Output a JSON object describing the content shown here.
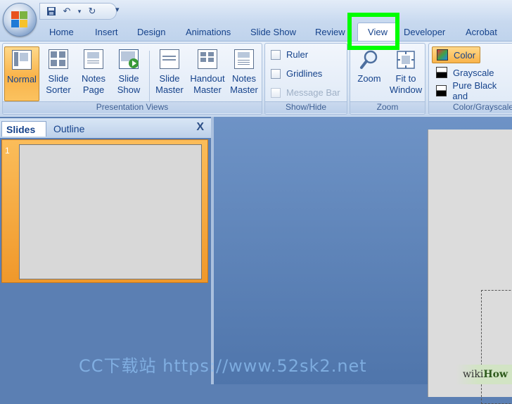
{
  "quick_access": {
    "icons": [
      "save-icon",
      "undo-icon",
      "redo-icon",
      "customize-icon"
    ],
    "undo_glyph": "↶",
    "redo_glyph": "↻",
    "more_glyph": "▾",
    "menu_glyph": "▾"
  },
  "tabs": [
    "Home",
    "Insert",
    "Design",
    "Animations",
    "Slide Show",
    "Review",
    "View",
    "Developer",
    "Acrobat"
  ],
  "active_tab": "View",
  "ribbon": {
    "presentation_views": {
      "label": "Presentation Views",
      "buttons": [
        {
          "line1": "Normal",
          "line2": "",
          "active": true
        },
        {
          "line1": "Slide",
          "line2": "Sorter"
        },
        {
          "line1": "Notes",
          "line2": "Page"
        },
        {
          "line1": "Slide",
          "line2": "Show"
        },
        {
          "line1": "Slide",
          "line2": "Master"
        },
        {
          "line1": "Handout",
          "line2": "Master"
        },
        {
          "line1": "Notes",
          "line2": "Master"
        }
      ]
    },
    "show_hide": {
      "label": "Show/Hide",
      "items": [
        {
          "label": "Ruler",
          "checked": false,
          "enabled": true
        },
        {
          "label": "Gridlines",
          "checked": false,
          "enabled": true
        },
        {
          "label": "Message Bar",
          "checked": false,
          "enabled": false
        }
      ]
    },
    "zoom": {
      "label": "Zoom",
      "buttons": [
        {
          "line1": "Zoom",
          "line2": ""
        },
        {
          "line1": "Fit to",
          "line2": "Window"
        }
      ]
    },
    "color_grayscale": {
      "label": "Color/Grayscale",
      "items": [
        {
          "label": "Color",
          "active": true
        },
        {
          "label": "Grayscale",
          "active": false
        },
        {
          "label": "Pure Black and",
          "active": false
        }
      ]
    }
  },
  "left_pane": {
    "tabs": [
      "Slides",
      "Outline"
    ],
    "close_glyph": "X",
    "slide_number": "1"
  },
  "watermark": "CC下载站 https://www.52sk2.net",
  "brand": {
    "wiki": "wiki",
    "how": "How"
  }
}
